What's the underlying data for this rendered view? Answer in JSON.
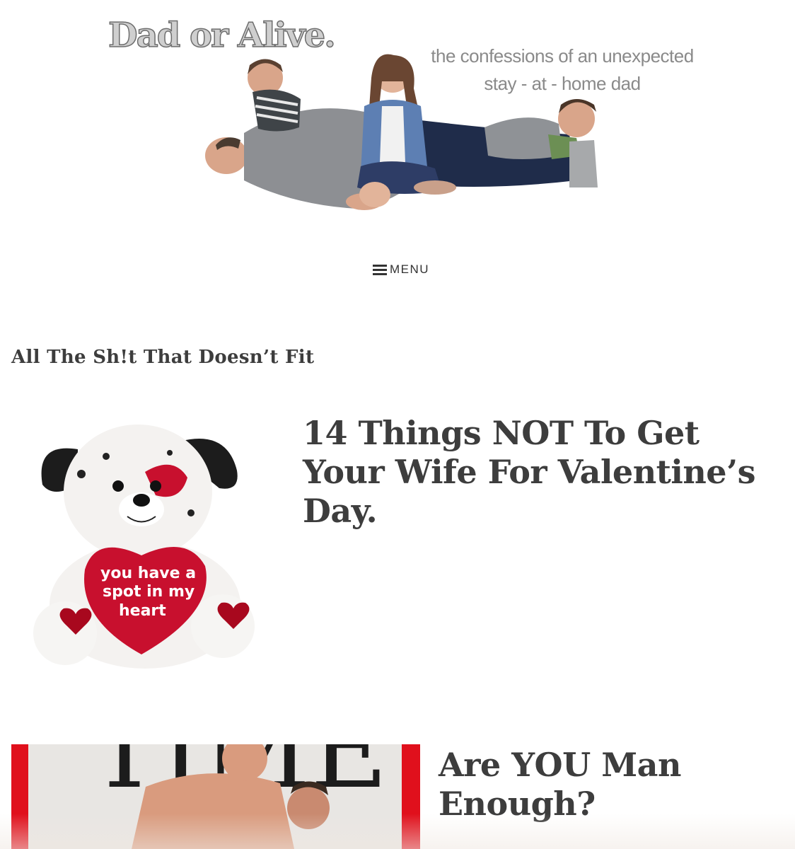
{
  "site": {
    "title": "Dad or Alive.",
    "tagline_line1": "the confessions of an unexpected",
    "tagline_line2": "stay - at - home dad"
  },
  "nav": {
    "menu_label": "MENU"
  },
  "archive": {
    "title": "All The Sh!t That Doesn’t Fit"
  },
  "posts": [
    {
      "title": "14 Things NOT To Get Your Wife For Valentine’s Day.",
      "thumb_text": [
        "you have a",
        "spot in my",
        "heart"
      ]
    },
    {
      "title": "Are YOU Man Enough?",
      "thumb_text": "TIME"
    }
  ],
  "colors": {
    "text": "#3d3d3d",
    "tagline": "#8a8a8a",
    "heart_red": "#c8102e",
    "time_red": "#e0101c"
  }
}
